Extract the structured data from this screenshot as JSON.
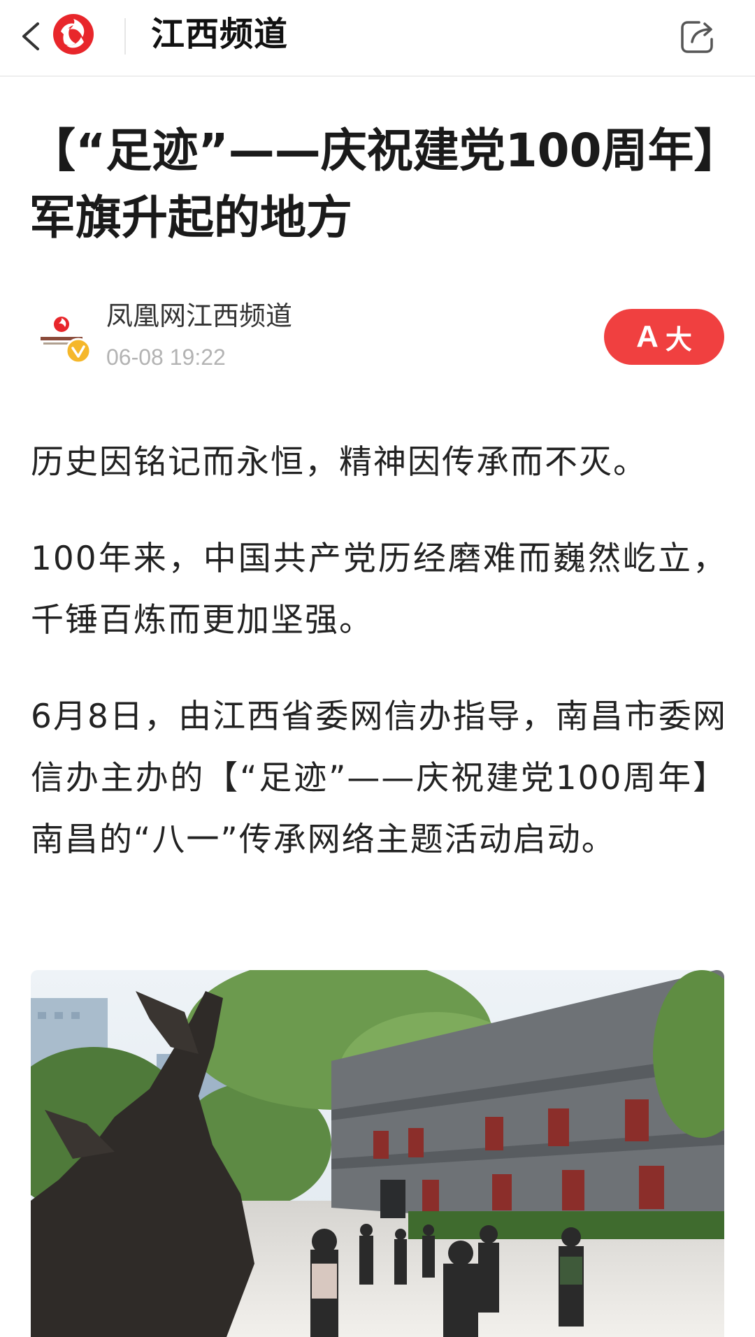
{
  "header": {
    "channel_title": "江西频道",
    "back_icon": "chevron-left-icon",
    "logo_icon": "phoenix-logo-icon",
    "share_icon": "share-icon"
  },
  "article": {
    "title": "【“足迹”——庆祝建党100周年】军旗升起的地方",
    "author": "凤凰网江西频道",
    "published": "06-08 19:22",
    "verified_icon": "verified-badge-icon",
    "font_button": {
      "aa_label": "A",
      "size_label": "大"
    },
    "paragraphs": [
      "历史因铭记而永恒，精神因传承而不灭。",
      "100年来，中国共产党历经磨难而巍然屹立，千锤百炼而更加坚强。",
      "6月8日，由江西省委网信办指导，南昌市委网信办主办的【“足迹”——庆祝建党100周年】南昌的“八一”传承网络主题活动启动。"
    ]
  },
  "colors": {
    "accent": "#f04040",
    "brand_red": "#e8262b",
    "verified": "#f5b72a",
    "muted_text": "#b3b3b3"
  }
}
